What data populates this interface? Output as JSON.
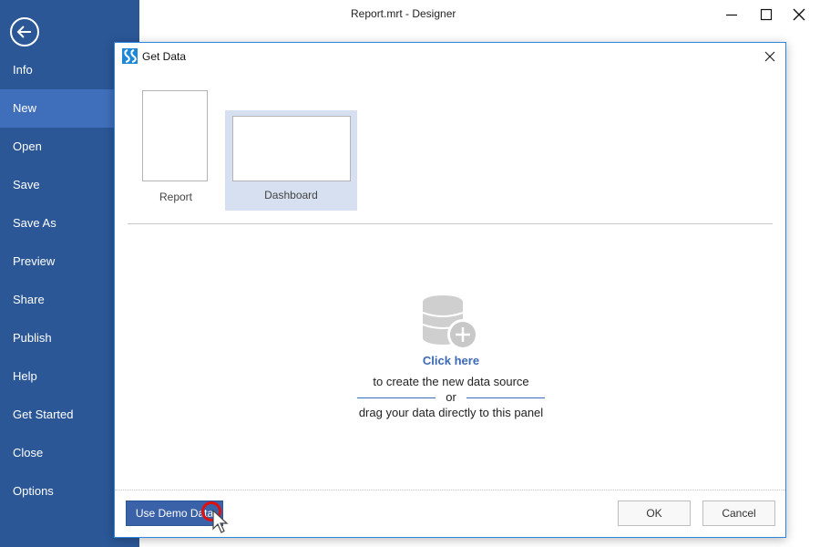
{
  "window": {
    "title": "Report.mrt - Designer",
    "controls": {
      "minimize_icon": "minimize-icon",
      "maximize_icon": "maximize-icon",
      "close_icon": "close-icon"
    }
  },
  "sidebar": {
    "back_icon": "back-arrow-icon",
    "active_color": "#3f6fba",
    "background_color": "#2b5797",
    "items": [
      {
        "label": "Info",
        "active": false
      },
      {
        "label": "New",
        "active": true
      },
      {
        "label": "Open",
        "active": false
      },
      {
        "label": "Save",
        "active": false
      },
      {
        "label": "Save As",
        "active": false
      },
      {
        "label": "Preview",
        "active": false
      },
      {
        "label": "Share",
        "active": false
      },
      {
        "label": "Publish",
        "active": false
      },
      {
        "label": "Help",
        "active": false
      },
      {
        "label": "Get Started",
        "active": false
      },
      {
        "label": "Close",
        "active": false
      },
      {
        "label": "Options",
        "active": false
      }
    ]
  },
  "dialog": {
    "title": "Get Data",
    "logo_icon": "stimulsoft-logo-icon",
    "close_icon": "close-icon",
    "templates": [
      {
        "label": "Report",
        "selected": false
      },
      {
        "label": "Dashboard",
        "selected": true
      }
    ],
    "drop_area": {
      "icon": "database-add-icon",
      "link_text": "Click here",
      "line1": "to create the new data source",
      "or_text": "or",
      "line2": "drag your data directly to this panel"
    },
    "buttons": {
      "demo": "Use Demo Data",
      "ok": "OK",
      "cancel": "Cancel"
    },
    "accent_color": "#3a6ab8"
  }
}
